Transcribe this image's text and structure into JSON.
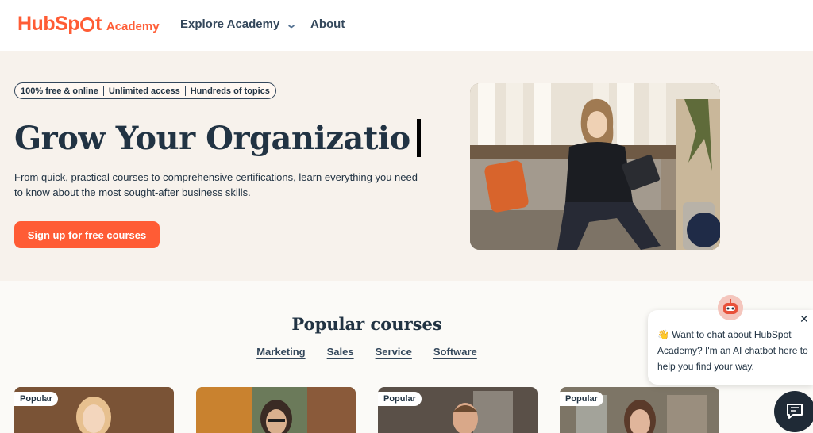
{
  "header": {
    "logo_text": "HubSpot",
    "logo_sub": "Academy",
    "nav": [
      {
        "label": "Explore Academy"
      },
      {
        "label": "About"
      }
    ]
  },
  "hero": {
    "pills": [
      "100% free & online",
      "Unlimited access",
      "Hundreds of topics"
    ],
    "title": "Grow Your Organizatio",
    "description": "From quick, practical courses to comprehensive certifications, learn everything you need to know about the most sought-after business skills.",
    "cta_label": "Sign up for free courses"
  },
  "popular": {
    "title": "Popular courses",
    "tabs": [
      "Marketing",
      "Sales",
      "Service",
      "Software"
    ],
    "cards": [
      {
        "badge": "Popular"
      },
      {
        "badge": ""
      },
      {
        "badge": "Popular"
      },
      {
        "badge": "Popular"
      }
    ]
  },
  "chat": {
    "message": "👋 Want to chat about HubSpot Academy? I'm an AI chatbot here to help you find your way."
  },
  "colors": {
    "brand": "#ff5c35",
    "text": "#213343",
    "hero_bg": "#f7f2ec"
  }
}
